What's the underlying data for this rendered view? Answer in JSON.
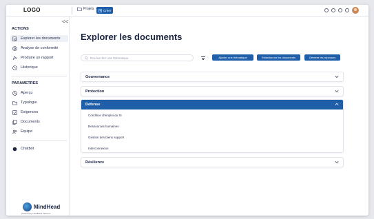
{
  "topbar": {
    "logo": "LOGO",
    "projects_label": "Projets",
    "create_label": "Créer"
  },
  "sidebar": {
    "collapse_glyph": "<<",
    "actions_title": "ACTIONS",
    "actions": [
      {
        "label": "Explorer les documents",
        "icon": "document-search-icon",
        "active": true
      },
      {
        "label": "Analyse de conformité",
        "icon": "target-icon"
      },
      {
        "label": "Produire un rapport",
        "icon": "report-icon"
      },
      {
        "label": "Historique",
        "icon": "history-icon"
      }
    ],
    "params_title": "PARAMETRES",
    "params": [
      {
        "label": "Aperçu",
        "icon": "overview-icon"
      },
      {
        "label": "Typologie",
        "icon": "folder-icon"
      },
      {
        "label": "Exigences",
        "icon": "checkbox-icon"
      },
      {
        "label": "Documents",
        "icon": "documents-icon"
      },
      {
        "label": "Equipe",
        "icon": "team-icon"
      }
    ],
    "chatbot": {
      "label": "Chatbot",
      "icon": "chatbot-icon"
    },
    "brand": {
      "name": "MindHead",
      "tagline": "powered by HeadMind Partners"
    }
  },
  "main": {
    "title": "Explorer les documents",
    "search_placeholder": "Rechercher une thématique",
    "buttons": {
      "add_theme": "Ajouter une thématique",
      "select_documents": "Sélectionner les documents",
      "generate_answers": "Générer les réponses"
    },
    "accordion": [
      {
        "label": "Gouvernance",
        "open": false
      },
      {
        "label": "Protection",
        "open": false
      },
      {
        "label": "Défense",
        "open": true,
        "items": [
          "Condition d'emploi du SI",
          "Ressources humaines",
          "Gestion des biens support",
          "Interconnexion"
        ]
      },
      {
        "label": "Résilience",
        "open": false
      }
    ]
  },
  "colors": {
    "accent": "#1f5ea8",
    "text": "#1c2540"
  }
}
